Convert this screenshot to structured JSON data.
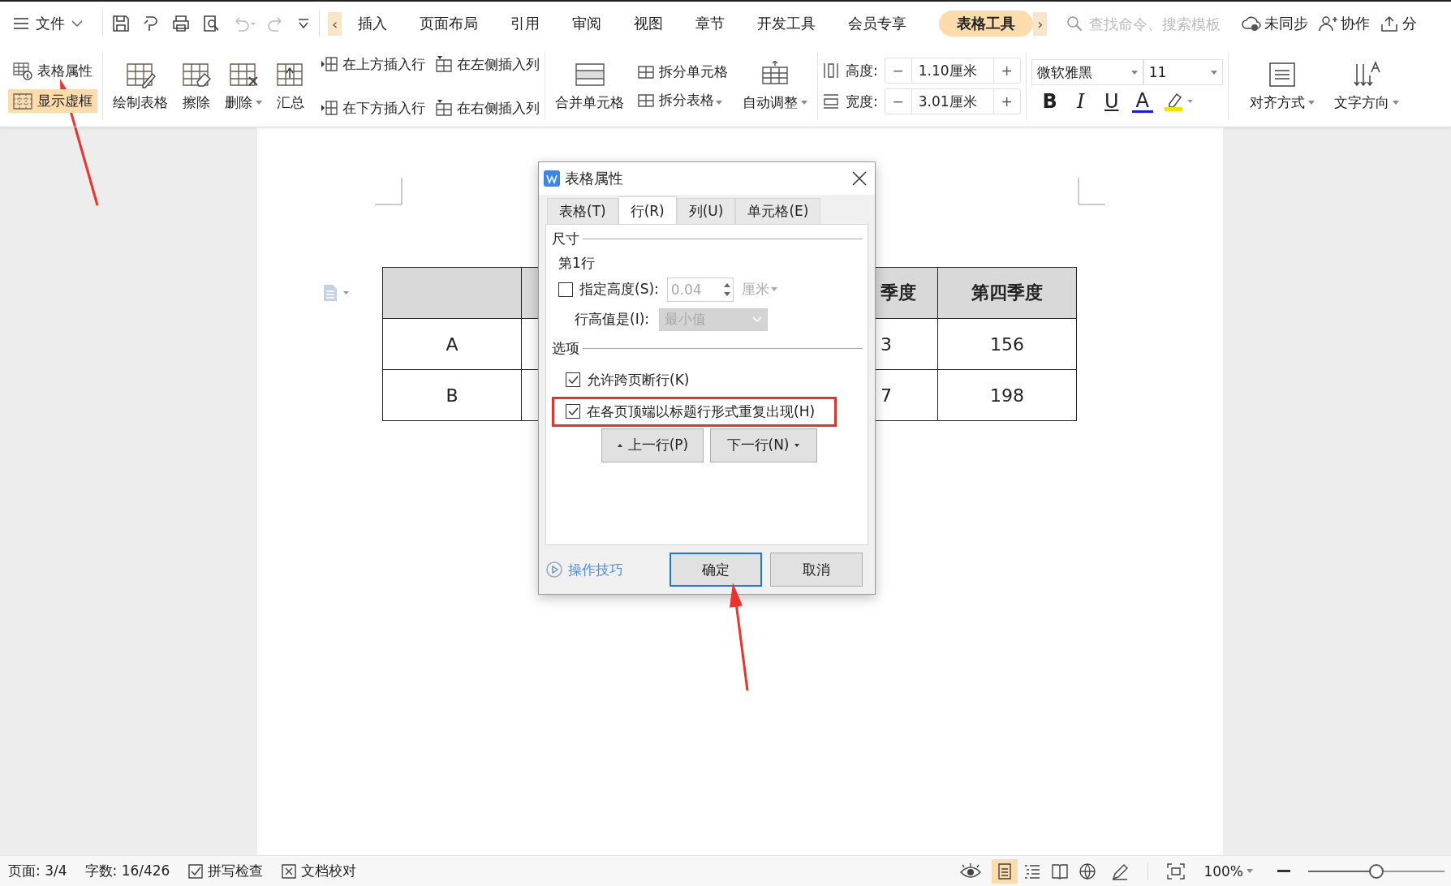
{
  "menu_bar": {
    "file_menu": "文件",
    "scroll_left": "‹",
    "scroll_right": "›",
    "tabs": [
      {
        "label": "插入",
        "selected": false
      },
      {
        "label": "页面布局",
        "selected": false
      },
      {
        "label": "引用",
        "selected": false
      },
      {
        "label": "审阅",
        "selected": false
      },
      {
        "label": "视图",
        "selected": false
      },
      {
        "label": "章节",
        "selected": false
      },
      {
        "label": "开发工具",
        "selected": false
      },
      {
        "label": "会员专享",
        "selected": false
      },
      {
        "label": "表格工具",
        "selected": true
      }
    ],
    "search": {
      "placeholder": "查找命令、搜索模板"
    },
    "actions": [
      {
        "label": "未同步",
        "kind": "cloud"
      },
      {
        "label": "协作",
        "kind": "person"
      },
      {
        "label": "分",
        "kind": "share"
      }
    ]
  },
  "ribbon": {
    "toggles": [
      {
        "label": "表格属性",
        "selected": false,
        "kind": "props"
      },
      {
        "label": "显示虚框",
        "selected": true,
        "kind": "grid"
      }
    ],
    "tools": [
      {
        "label": "绘制表格",
        "kind": "draw",
        "has_menu": false
      },
      {
        "label": "擦除",
        "kind": "erase",
        "has_menu": false
      },
      {
        "label": "删除",
        "kind": "delete",
        "has_menu": true
      },
      {
        "label": "汇总",
        "kind": "sum",
        "has_menu": false
      }
    ],
    "insert": [
      {
        "label": "在上方插入行",
        "kind": "row"
      },
      {
        "label": "在下方插入行",
        "kind": "row"
      },
      {
        "label": "在左侧插入列",
        "kind": "col"
      },
      {
        "label": "在右侧插入列",
        "kind": "col"
      }
    ],
    "merge": "合并单元格",
    "split": [
      {
        "label": "拆分单元格",
        "has_menu": false
      },
      {
        "label": "拆分表格",
        "has_menu": true
      }
    ],
    "autofit": "自动调整",
    "size": [
      {
        "label": "高度:",
        "value": "1.10厘米",
        "kind": "height",
        "decrement": "−",
        "increment": "+"
      },
      {
        "label": "宽度:",
        "value": "3.01厘米",
        "kind": "width",
        "decrement": "−",
        "increment": "+"
      }
    ],
    "font": {
      "family": "微软雅黑",
      "size": "11"
    },
    "format": [
      {
        "label": "B",
        "kind": "bold"
      },
      {
        "label": "I",
        "kind": "italic"
      },
      {
        "label": "U",
        "kind": "underline"
      },
      {
        "label": "A",
        "kind": "color"
      },
      {
        "kind": "highlight"
      }
    ],
    "align": "对齐方式",
    "direction": "文字方向"
  },
  "table": {
    "header": [
      "季度",
      "第四季度"
    ],
    "rows": [
      [
        "A",
        "3",
        "156"
      ],
      [
        "B",
        "7",
        "198"
      ]
    ]
  },
  "dialog": {
    "title": "表格属性",
    "tabs": [
      {
        "label": "表格(T)",
        "selected": false
      },
      {
        "label": "行(R)",
        "selected": true
      },
      {
        "label": "列(U)",
        "selected": false
      },
      {
        "label": "单元格(E)",
        "selected": false
      }
    ],
    "size_section": "尺寸",
    "row_label": "第1行",
    "height": {
      "label": "指定高度(S):",
      "checked": false,
      "value": "0.04",
      "unit": "厘米"
    },
    "height_mode": {
      "label": "行高值是(I):",
      "value": "最小值",
      "disabled": true
    },
    "options_section": "选项",
    "options": [
      {
        "label": "允许跨页断行(K)",
        "checked": true,
        "highlighted": false
      },
      {
        "label": "在各页顶端以标题行形式重复出现(H)",
        "checked": true,
        "highlighted": true
      }
    ],
    "nav": [
      "上一行(P)",
      "下一行(N)"
    ],
    "tips": "操作技巧",
    "ok": "确定",
    "cancel": "取消"
  },
  "status_bar": {
    "page": "页面: 3/4",
    "words": "字数: 16/426",
    "spell": "拼写检查",
    "proof": "文档校对",
    "views": [
      {
        "selected": true
      },
      {
        "selected": false
      },
      {
        "selected": false
      },
      {
        "selected": false
      }
    ],
    "zoom": "100%",
    "zoom_slider": {
      "level": 0.5
    }
  }
}
